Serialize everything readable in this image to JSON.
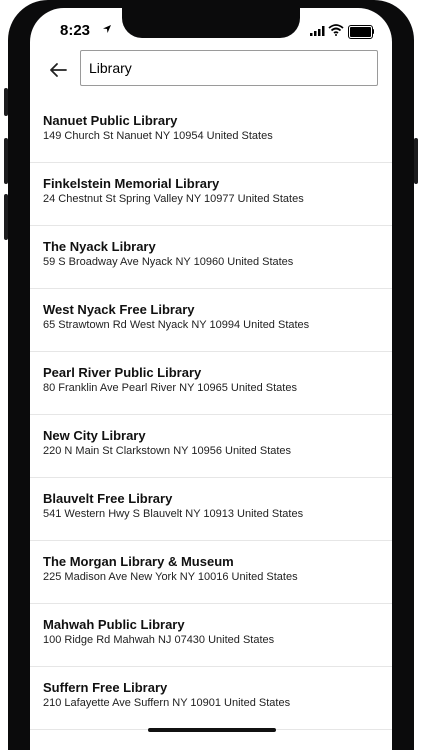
{
  "status_bar": {
    "time": "8:23"
  },
  "search": {
    "value": "Library"
  },
  "results": [
    {
      "name": "Nanuet Public Library",
      "address": "149 Church St Nanuet NY 10954 United States"
    },
    {
      "name": "Finkelstein Memorial Library",
      "address": "24 Chestnut St Spring Valley NY 10977 United States"
    },
    {
      "name": "The Nyack Library",
      "address": "59 S Broadway Ave Nyack NY 10960 United States"
    },
    {
      "name": "West Nyack Free Library",
      "address": "65 Strawtown Rd West Nyack NY 10994 United States"
    },
    {
      "name": "Pearl River Public Library",
      "address": "80 Franklin Ave Pearl River NY 10965 United States"
    },
    {
      "name": "New City Library",
      "address": "220 N Main St Clarkstown NY 10956 United States"
    },
    {
      "name": "Blauvelt Free Library",
      "address": "541 Western Hwy S Blauvelt NY 10913 United States"
    },
    {
      "name": "The Morgan Library & Museum",
      "address": "225 Madison Ave New York NY 10016 United States"
    },
    {
      "name": "Mahwah Public Library",
      "address": "100 Ridge Rd Mahwah NJ 07430 United States"
    },
    {
      "name": "Suffern Free Library",
      "address": "210 Lafayette Ave Suffern NY 10901 United States"
    }
  ]
}
